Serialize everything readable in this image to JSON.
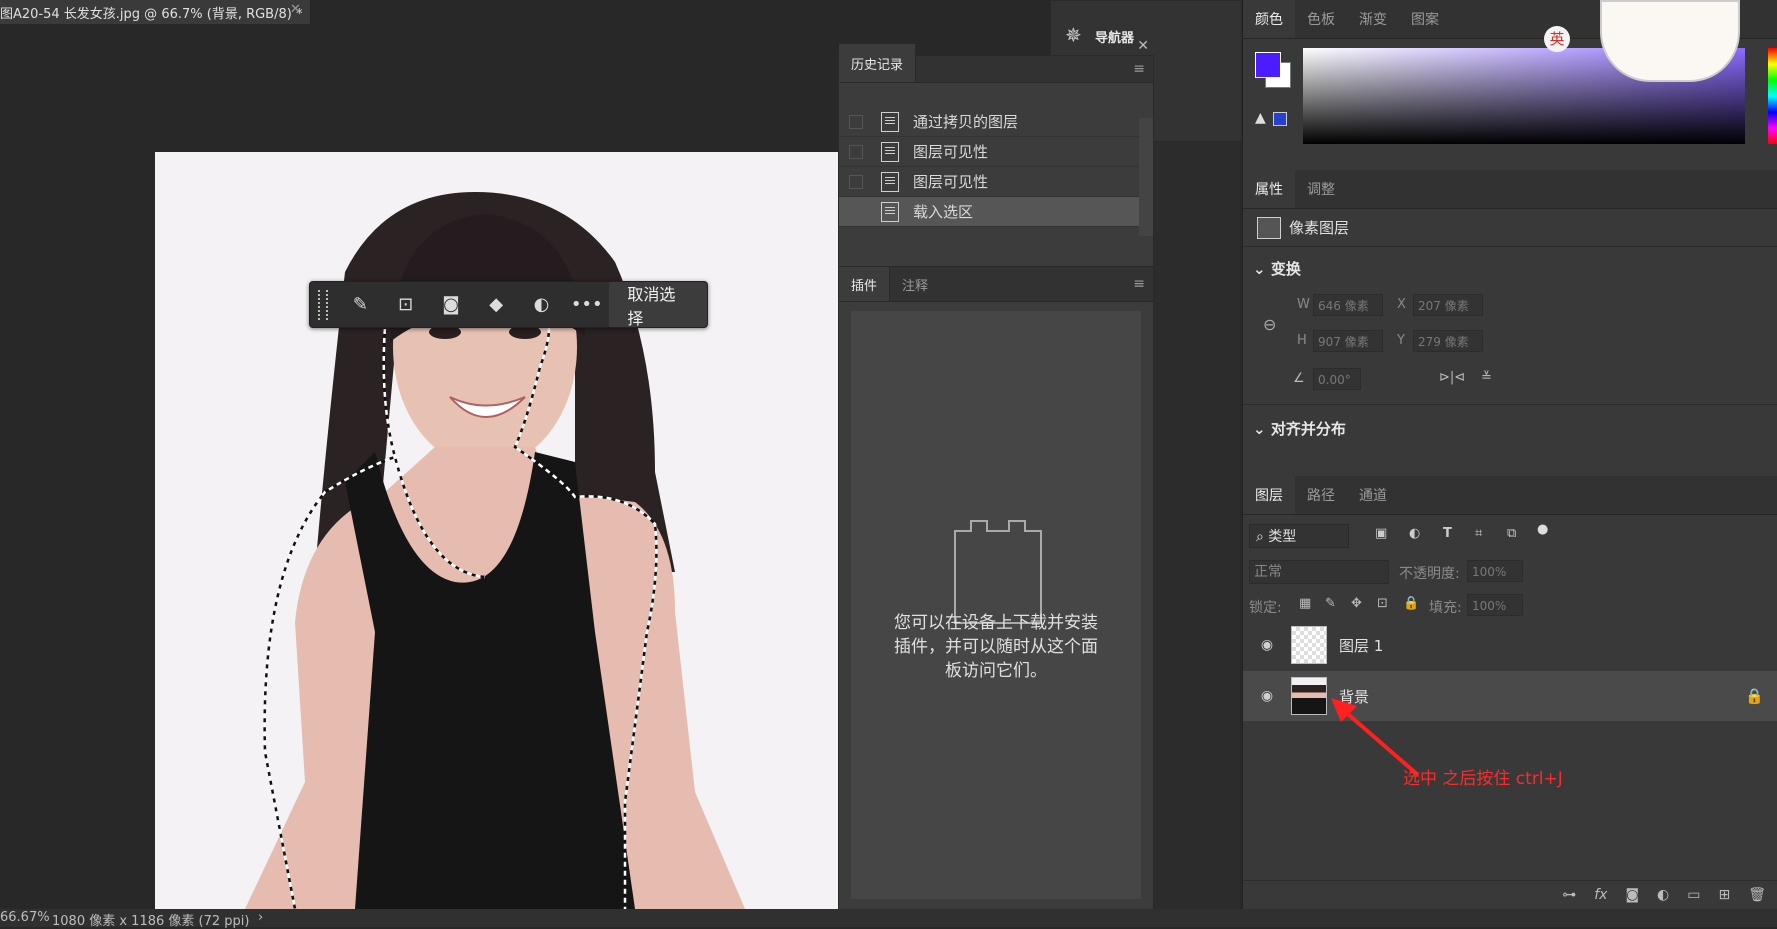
{
  "document": {
    "title": "图A20-54 长发女孩.jpg @ 66.7% (背景, RGB/8) *",
    "zoom": "66.67%",
    "dimensions": "1080 像素 x 1186 像素 (72 ppi)"
  },
  "context_toolbar": {
    "deselect_label": "取消选择",
    "tools": [
      "brush-icon",
      "selection-transform-icon",
      "mask-icon",
      "fill-icon",
      "adjust-icon",
      "more-icon"
    ]
  },
  "history": {
    "tab": "历史记录",
    "items": [
      {
        "label": "通过拷贝的图层",
        "selected": false
      },
      {
        "label": "图层可见性",
        "selected": false
      },
      {
        "label": "图层可见性",
        "selected": false
      },
      {
        "label": "载入选区",
        "selected": true
      }
    ]
  },
  "plugins": {
    "tabs": [
      "插件",
      "注释"
    ],
    "message_line1": "您可以在设备上下载并安装",
    "message_line2": "插件，并可以随时从这个面",
    "message_line3": "板访问它们。"
  },
  "navigator": {
    "label": "导航器"
  },
  "color_panel": {
    "tabs": [
      "颜色",
      "色板",
      "渐变",
      "图案"
    ],
    "foreground": "#4a1cff",
    "background": "#ffffff"
  },
  "properties": {
    "tabs": [
      "属性",
      "调整"
    ],
    "layer_type": "像素图层",
    "transform_title": "变换",
    "w": "646 像素",
    "h": "907 像素",
    "x": "207 像素",
    "y": "279 像素",
    "angle": "0.00°",
    "align_title": "对齐并分布",
    "labels": {
      "w": "W",
      "h": "H",
      "x": "X",
      "y": "Y"
    }
  },
  "layers": {
    "tabs": [
      "图层",
      "路径",
      "通道"
    ],
    "filter_label": "类型",
    "blend_mode": "正常",
    "opacity_label": "不透明度:",
    "opacity": "100%",
    "lock_label": "锁定:",
    "fill_label": "填充:",
    "fill": "100%",
    "items": [
      {
        "name": "图层 1",
        "selected": false
      },
      {
        "name": "背景",
        "selected": true
      }
    ],
    "annotation": "选中  之后按住 ctrl+J"
  },
  "ime": {
    "label": "英"
  }
}
